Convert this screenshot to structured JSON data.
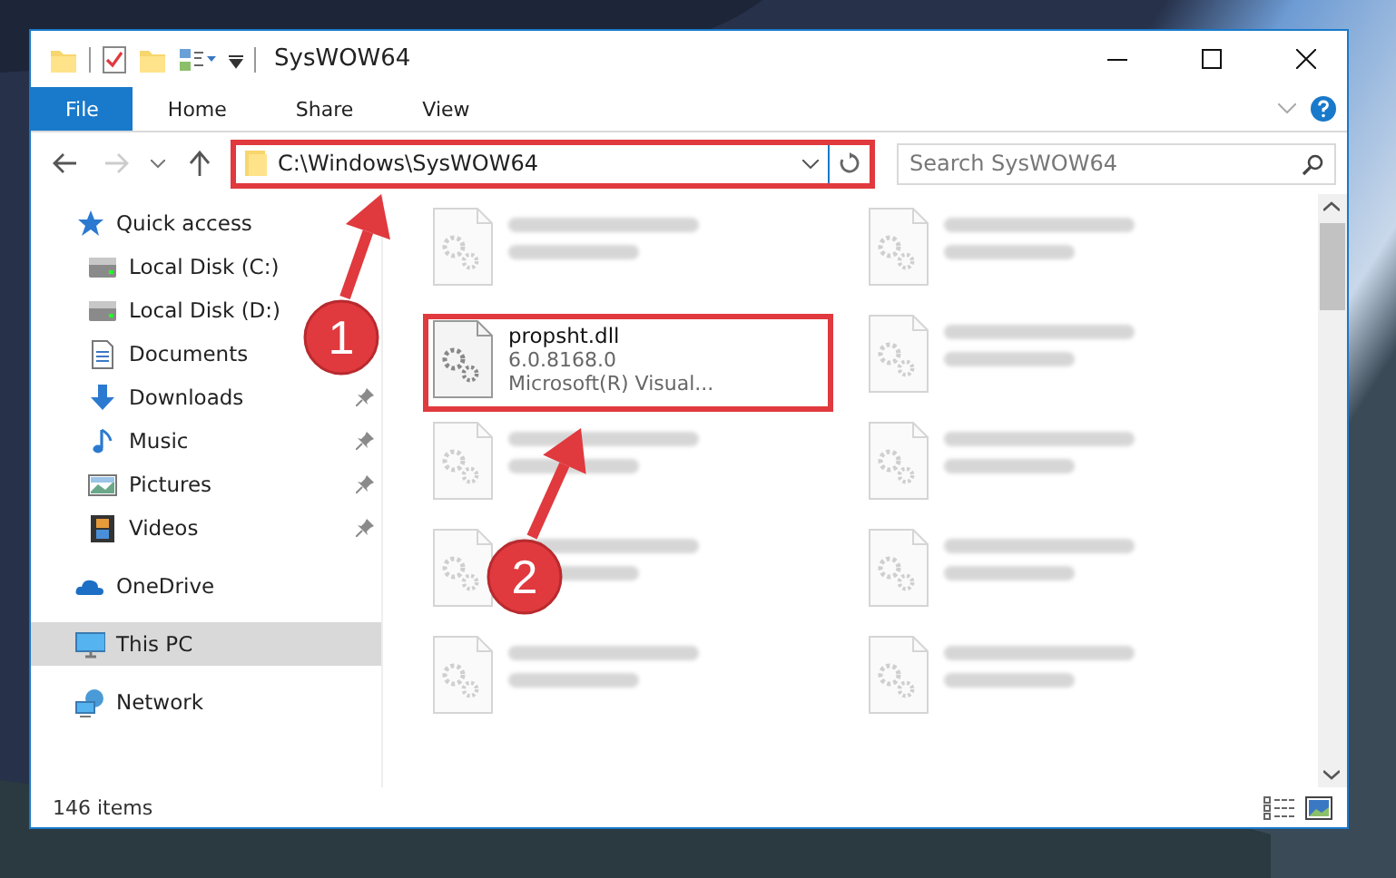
{
  "window": {
    "title": "SysWOW64"
  },
  "ribbon_tabs": [
    {
      "label": "File",
      "kind": "file"
    },
    {
      "label": "Home",
      "kind": "tab"
    },
    {
      "label": "Share",
      "kind": "tab"
    },
    {
      "label": "View",
      "kind": "tab"
    }
  ],
  "address": {
    "path": "C:\\Windows\\SysWOW64",
    "highlighted": true
  },
  "search": {
    "placeholder": "Search SysWOW64"
  },
  "nav": [
    {
      "label": "Quick access",
      "kind": "star",
      "selected": false,
      "pinned": false,
      "children": [
        {
          "label": "Local Disk (C:)",
          "kind": "drive",
          "selected": false,
          "pinned": false
        },
        {
          "label": "Local Disk (D:)",
          "kind": "drive",
          "selected": false,
          "pinned": false
        },
        {
          "label": "Documents",
          "kind": "documents",
          "selected": false,
          "pinned": false
        },
        {
          "label": "Downloads",
          "kind": "downloads",
          "selected": false,
          "pinned": true
        },
        {
          "label": "Music",
          "kind": "music",
          "selected": false,
          "pinned": true
        },
        {
          "label": "Pictures",
          "kind": "pictures",
          "selected": false,
          "pinned": true
        },
        {
          "label": "Videos",
          "kind": "videos",
          "selected": false,
          "pinned": true
        }
      ]
    },
    {
      "label": "OneDrive",
      "kind": "cloud",
      "selected": false,
      "pinned": false
    },
    {
      "label": "This PC",
      "kind": "pc",
      "selected": true,
      "pinned": false
    },
    {
      "label": "Network",
      "kind": "network",
      "selected": false,
      "pinned": false
    }
  ],
  "files": [
    {
      "kind": "blurred"
    },
    {
      "kind": "blurred"
    },
    {
      "kind": "file",
      "name": "propsht.dll",
      "lines": [
        "6.0.8168.0",
        "Microsoft(R) Visual..."
      ],
      "highlighted": true
    },
    {
      "kind": "blurred"
    },
    {
      "kind": "blurred"
    },
    {
      "kind": "blurred"
    },
    {
      "kind": "blurred"
    },
    {
      "kind": "blurred"
    },
    {
      "kind": "blurred"
    },
    {
      "kind": "blurred"
    }
  ],
  "status_bar": {
    "count": "146 items"
  },
  "callouts": [
    {
      "number": "1"
    },
    {
      "number": "2"
    }
  ]
}
